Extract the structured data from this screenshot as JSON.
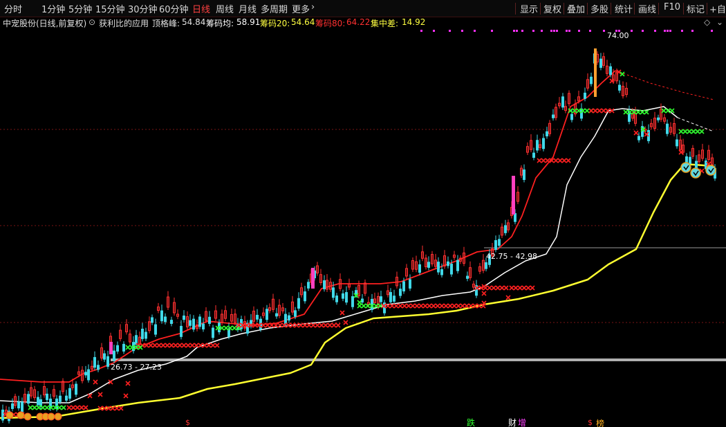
{
  "toolbar": {
    "periods": [
      "分时",
      "1分钟",
      "5分钟",
      "15分钟",
      "30分钟",
      "60分钟",
      "日线",
      "周线",
      "月线",
      "多周期",
      "更多"
    ],
    "active_period": "日线",
    "tools": [
      "显示",
      "复权",
      "叠加",
      "多股",
      "统计",
      "画线",
      "F10",
      "标记",
      "+自选"
    ]
  },
  "info": {
    "stock": "中宠股份(日线,前复权)",
    "indicator": "获利比的应用",
    "peak_label": "顶格峰:",
    "peak_value": "54.84",
    "avg_label": "筹码均:",
    "avg_value": "58.91",
    "c20_label": "筹码20:",
    "c20_value": "54.64",
    "c80_label": "筹码80:",
    "c80_value": "64.22",
    "conc_label": "集中差:",
    "conc_value": "14.92"
  },
  "annotations": {
    "high": "74.00",
    "range_mid": "42.75 - 42.98",
    "range_low": "26.73 - 27.23"
  },
  "markers": {
    "dollar": "$",
    "die": "跌",
    "cai": "财",
    "zeng": "增",
    "bang": "榜"
  },
  "colors": {
    "up": "#ff3030",
    "down": "#40d8e8",
    "ma_short": "#ff2020",
    "ma_long": "#ffffff",
    "chip_avg": "#ffff30",
    "cross_red": "#ff2020",
    "cross_green": "#30ff30",
    "dots": "#ff30ff",
    "pink": "#ff40c0",
    "active": "#ff4040"
  }
}
